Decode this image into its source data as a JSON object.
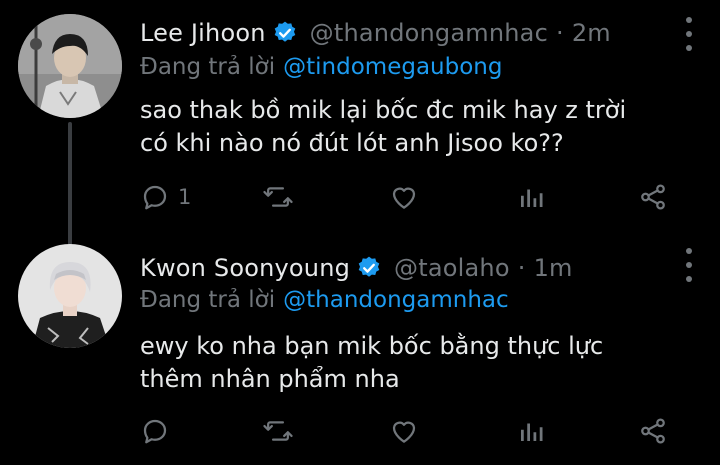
{
  "colors": {
    "background": "#000000",
    "text": "#e7e9ea",
    "muted": "#71767b",
    "link": "#1d9bf0",
    "verified": "#1d9bf0",
    "thread_line": "#3a3d41"
  },
  "tweets": [
    {
      "author_name": "Lee Jihoon",
      "handle": "@thandongamnhac",
      "separator": "·",
      "time": "2m",
      "reply_prefix": "Đang trả lời",
      "reply_mention": "@tindomegaubong",
      "body_lines": [
        "sao thak bồ mik lại bốc đc mik hay z trời",
        "có khi nào nó đút lót anh Jisoo ko??"
      ],
      "reply_count": "1",
      "verified": true,
      "icons": [
        "reply-icon",
        "retweet-icon",
        "like-icon",
        "views-icon",
        "share-icon",
        "more-icon"
      ]
    },
    {
      "author_name": "Kwon Soonyoung",
      "handle": "@taolaho",
      "separator": "·",
      "time": "1m",
      "reply_prefix": "Đang trả lời",
      "reply_mention": "@thandongamnhac",
      "body_lines": [
        "ewy ko nha bạn mik bốc bằng thực lực",
        "thêm nhân phẩm nha"
      ],
      "reply_count": "",
      "verified": true,
      "icons": [
        "reply-icon",
        "retweet-icon",
        "like-icon",
        "views-icon",
        "share-icon",
        "more-icon"
      ]
    }
  ]
}
